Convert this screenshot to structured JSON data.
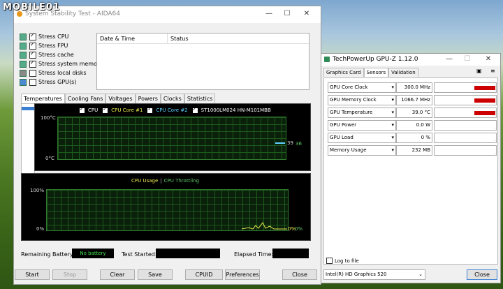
{
  "watermark": "MOBILE01",
  "aida": {
    "title": "System Stability Test - AIDA64",
    "stress_items": [
      {
        "label": "Stress CPU",
        "checked": true
      },
      {
        "label": "Stress FPU",
        "checked": true
      },
      {
        "label": "Stress cache",
        "checked": true
      },
      {
        "label": "Stress system memory",
        "checked": true
      },
      {
        "label": "Stress local disks",
        "checked": false
      },
      {
        "label": "Stress GPU(s)",
        "checked": false
      }
    ],
    "log_headers": {
      "date": "Date & Time",
      "status": "Status"
    },
    "tabs": [
      "Temperatures",
      "Cooling Fans",
      "Voltages",
      "Powers",
      "Clocks",
      "Statistics"
    ],
    "temp_graph": {
      "legend": [
        {
          "label": "CPU",
          "color": "#ffffff"
        },
        {
          "label": "CPU Core #1",
          "color": "#e8e84a"
        },
        {
          "label": "CPU Core #2",
          "color": "#5fd0ff"
        },
        {
          "label": "ST1000LM024 HN-M101MBB",
          "color": "#ffffff"
        }
      ],
      "y_top": "100°C",
      "y_bottom": "0°C",
      "value_a": "39",
      "value_b": "36"
    },
    "usage_graph": {
      "title_a": "CPU Usage",
      "separator": "|",
      "title_b": "CPU Throttling",
      "y_top": "100%",
      "y_bottom": "0%",
      "value_a": "0%",
      "value_b": "0%"
    },
    "status": {
      "battery_label": "Remaining Battery:",
      "battery_value": "No battery",
      "started_label": "Test Started:",
      "elapsed_label": "Elapsed Time:"
    },
    "buttons": {
      "start": "Start",
      "stop": "Stop",
      "clear": "Clear",
      "save": "Save",
      "cpuid": "CPUID",
      "preferences": "Preferences",
      "close": "Close"
    }
  },
  "gpuz": {
    "title": "TechPowerUp GPU-Z 1.12.0",
    "tabs": [
      "Graphics Card",
      "Sensors",
      "Validation"
    ],
    "sensors": [
      {
        "name": "GPU Core Clock",
        "value": "300.0 MHz",
        "fill": 0.35
      },
      {
        "name": "GPU Memory Clock",
        "value": "1066.7 MHz",
        "fill": 0.35
      },
      {
        "name": "GPU Temperature",
        "value": "39.0 °C",
        "fill": 0.35
      },
      {
        "name": "GPU Power",
        "value": "0.0 W",
        "fill": 0
      },
      {
        "name": "GPU Load",
        "value": "0 %",
        "fill": 0
      },
      {
        "name": "Memory Usage",
        "value": "232 MB",
        "fill": 0
      }
    ],
    "log_label": "Log to file",
    "device": "Intel(R) HD Graphics 520",
    "close": "Close"
  }
}
